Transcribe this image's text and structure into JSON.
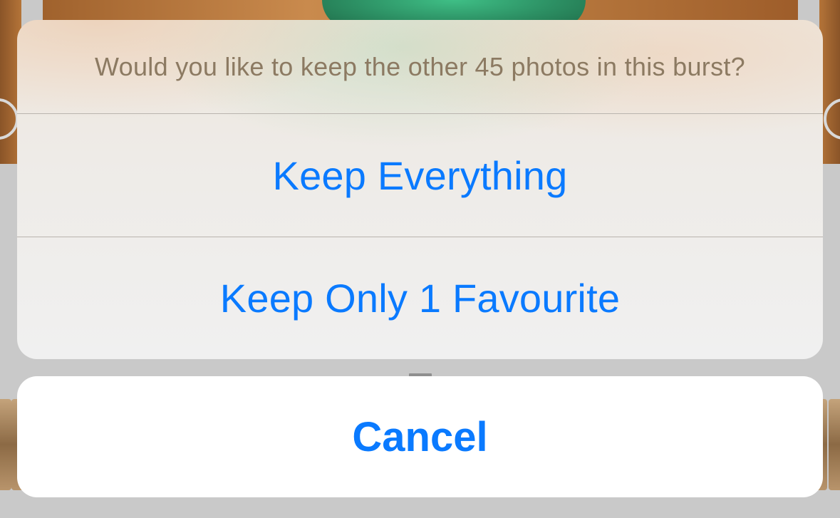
{
  "sheet": {
    "message": "Would you like to keep the other 45 photos in this burst?",
    "options": [
      {
        "label": "Keep Everything"
      },
      {
        "label": "Keep Only 1 Favourite"
      }
    ],
    "cancel_label": "Cancel"
  },
  "colors": {
    "accent": "#0a7aff",
    "message_text": "#8c7a62",
    "backdrop": "#c9c9c9"
  }
}
